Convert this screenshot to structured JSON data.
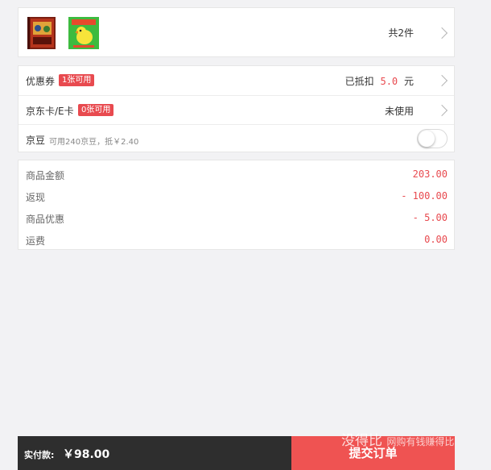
{
  "products": {
    "items": [
      {
        "icon": "book-product-thumbnail"
      },
      {
        "icon": "duck-book-product-thumbnail"
      }
    ],
    "count_text": "共2件"
  },
  "coupons": {
    "coupon_label": "优惠券",
    "coupon_badge": "1张可用",
    "deducted_prefix": "已抵扣",
    "deducted_amount": "5.0",
    "deducted_suffix": "元",
    "card_label": "京东卡/E卡",
    "card_badge": "0张可用",
    "card_status": "未使用",
    "beans_label": "京豆",
    "beans_info": "可用240京豆，抵￥2.40"
  },
  "amounts": {
    "rows": [
      {
        "label": "商品金额",
        "value": "203.00"
      },
      {
        "label": "返现",
        "value": "- 100.00"
      },
      {
        "label": "商品优惠",
        "value": "- 5.00"
      },
      {
        "label": "运费",
        "value": "0.00"
      }
    ]
  },
  "bottom": {
    "pay_label": "实付款:",
    "pay_amount": "￥98.00",
    "submit_label": "提交订单"
  },
  "watermark": {
    "brand": "没得比",
    "tagline": "网购有钱赚得比"
  },
  "colors": {
    "accent": "#e84a4f",
    "submit": "#ef5352",
    "bar_dark": "#2e2e2e",
    "background": "#f2f2f4"
  }
}
